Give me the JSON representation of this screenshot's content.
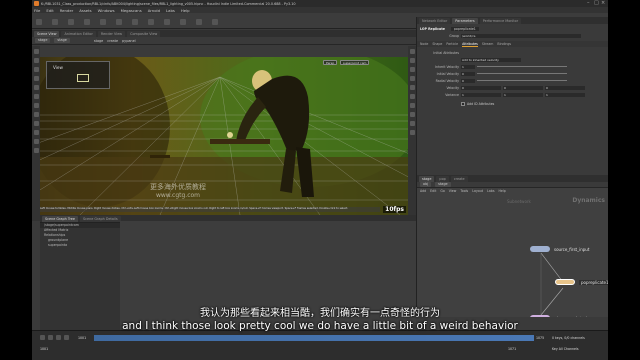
{
  "titlebar": {
    "title": "K:/RBL1031_Class_production/RBL1/cinfo/ABK004/lighting/scene_files/RBL1_lighting_v005.hipnc - Houdini Indie Limited-Commercial 20.0.688 - Py3.10"
  },
  "menubar": {
    "items": [
      "File",
      "Edit",
      "Render",
      "Assets",
      "Windows",
      "Megascans",
      "Arnold",
      "Labs",
      "Help"
    ]
  },
  "left_pane": {
    "tabs": [
      "Scene View",
      "Animation Editor",
      "Render View",
      "Composite View"
    ],
    "path": [
      "stage",
      "stage"
    ],
    "stage_label": "stage",
    "create_label": "create",
    "preset_label": "pypanel"
  },
  "viewport": {
    "view_label": "View",
    "persp_label": "Persp",
    "cam_label": "superpoint cam",
    "fps": "10fps",
    "watermark_cn": "更多海外优质教程",
    "watermark_url": "www.cgtg.com",
    "status_text": "Left mouse tumbles. Middle mouse pans. Right mouse dollies. Ctrl+Alt+Left mouse box zooms. Ctrl+Right mouse box zooms out. Right to left box zooms in/out. Space+H homes viewport. Space+F frames selected. Double-click to select."
  },
  "outliner": {
    "tabs": [
      "Scene Graph Tree",
      "Scene Graph Details"
    ],
    "path_label": "/stage/superpointcam",
    "rows": [
      "Affected Matrix",
      "Relationships",
      "groundplane",
      "superpointa"
    ]
  },
  "parm_panel": {
    "tabs": [
      "Network Editor",
      "Parameters",
      "Performance Monitor"
    ],
    "node_type": "LOP Replicate",
    "node_name": "popreplicate1",
    "group_label": "Group",
    "group_value": "/world/cs",
    "attr_tabs": [
      "Node",
      "Shape",
      "Particle",
      "Attributes",
      "Stream",
      "Bindings"
    ],
    "rows": [
      {
        "label": "Initial Attributes",
        "values": []
      },
      {
        "label": "Add to Inherited Velocity",
        "values": [
          "Add to inherited velocity"
        ]
      },
      {
        "label": "Inherit Velocity",
        "values": [
          "1"
        ]
      },
      {
        "label": "Initial Velocity",
        "values": [
          "0"
        ]
      },
      {
        "label": "Radial Velocity",
        "values": [
          "0"
        ]
      },
      {
        "label": "Velocity",
        "values": [
          "0",
          "0",
          "0"
        ]
      },
      {
        "label": "Variance",
        "values": [
          "1",
          "1",
          "1"
        ]
      }
    ],
    "checkbox_label": "Add ID Attributes"
  },
  "network": {
    "tabs": [
      "stage",
      "pop",
      "create"
    ],
    "path": [
      "obj",
      "stage"
    ],
    "menu": [
      "Add",
      "Edit",
      "Go",
      "View",
      "Tools",
      "Layout",
      "Labs",
      "Help"
    ],
    "bg_title": "Dynamics",
    "bg_sub": "Subnetwork",
    "nodes": [
      {
        "name": "source_first_input",
        "color": "#9fb0d0"
      },
      {
        "name": "popreplicate1",
        "color": "#e8c48a"
      },
      {
        "name": "wire_pops_into_here",
        "color": "#d0b0e0"
      }
    ]
  },
  "playbar": {
    "start_frame": "1001",
    "end_frame": "1071",
    "current_frame": "1001",
    "range_end": "1075",
    "keys_label": "0 keys, 0/0 channels",
    "key_all_label": "Key All Channels"
  },
  "subtitles": {
    "cn": "我认为那些看起来相当酷，我们确实有一点奇怪的行为",
    "en": "and I think those look pretty cool we do have a little bit of a weird behavior"
  }
}
